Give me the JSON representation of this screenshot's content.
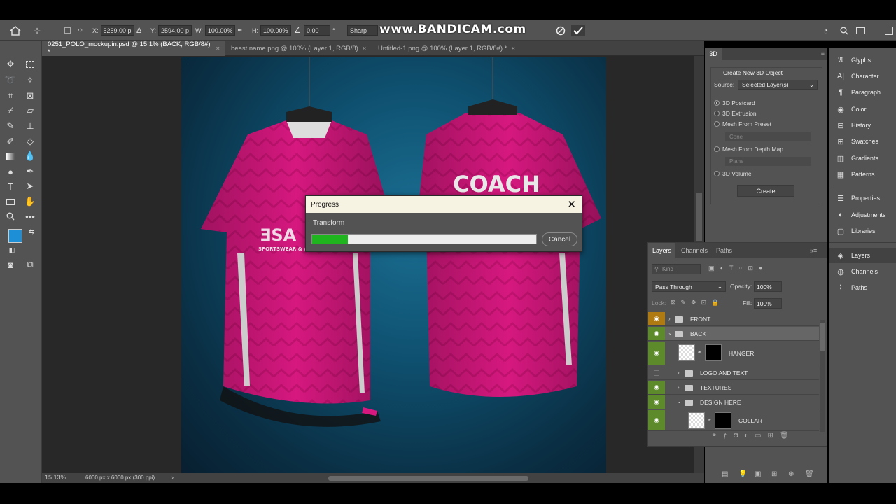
{
  "options_bar": {
    "x_label": "X:",
    "x_value": "5259.00 p",
    "y_label": "Y:",
    "y_value": "2594.00 p",
    "w_label": "W:",
    "w_value": "100.00%",
    "h_label": "H:",
    "h_value": "100.00%",
    "angle_value": "0.00",
    "angle_unit": "°",
    "interp_value": "Sharp",
    "watermark": "www.BANDICAM.com"
  },
  "tabs": [
    {
      "label": "0251_POLO_mockupin.psd @ 15.1% (BACK, RGB/8#) *",
      "close": "×"
    },
    {
      "label": "beast name.png @ 100% (Layer 1, RGB/8)",
      "close": "×"
    },
    {
      "label": "Untitled-1.png @ 100% (Layer 1, RGB/8#) *",
      "close": "×"
    }
  ],
  "artwork": {
    "front_logo_text": "ƎSA",
    "front_logo_sub": "SPORTSWEAR & A",
    "back_text": "COACH",
    "shirt_color": "#d6187f",
    "bg_color": "#0e4f6e"
  },
  "status_bar": {
    "zoom": "15.13%",
    "doc_info": "6000 px x 6000 px (300 ppi)",
    "arrow": "›"
  },
  "progress_dialog": {
    "title": "Progress",
    "task": "Transform",
    "progress_fraction": 0.16,
    "cancel_label": "Cancel",
    "close": "✕"
  },
  "panel_3d": {
    "tab_label": "3D",
    "heading": "Create New 3D Object",
    "source_label": "Source:",
    "source_value": "Selected Layer(s)",
    "options": [
      {
        "label": "3D Postcard",
        "selected": true
      },
      {
        "label": "3D Extrusion",
        "selected": false
      },
      {
        "label": "Mesh From Preset",
        "selected": false
      },
      {
        "label": "Mesh From Depth Map",
        "selected": false
      },
      {
        "label": "3D Volume",
        "selected": false
      }
    ],
    "preset_value": "Cone",
    "depth_value": "Plane",
    "create_label": "Create"
  },
  "layers_panel": {
    "tabs": [
      "Layers",
      "Channels",
      "Paths"
    ],
    "kind_placeholder": "Kind",
    "blend_mode": "Pass Through",
    "opacity_label": "Opacity:",
    "opacity_value": "100%",
    "lock_label": "Lock:",
    "fill_label": "Fill:",
    "fill_value": "100%",
    "rows": [
      {
        "name": "FRONT",
        "type": "folder"
      },
      {
        "name": "BACK",
        "type": "folder"
      },
      {
        "name": "HANGER",
        "type": "layer"
      },
      {
        "name": "LOGO AND TEXT",
        "type": "folder"
      },
      {
        "name": "TEXTURES",
        "type": "folder"
      },
      {
        "name": "DESIGN HERE",
        "type": "folder"
      },
      {
        "name": "COLLAR",
        "type": "layer"
      }
    ]
  },
  "right_panels": {
    "group1": [
      "Glyphs",
      "Character",
      "Paragraph",
      "Color",
      "History",
      "Swatches",
      "Gradients",
      "Patterns"
    ],
    "group2": [
      "Properties",
      "Adjustments",
      "Libraries"
    ],
    "group3": [
      "Layers",
      "Channels",
      "Paths"
    ]
  },
  "colors": {
    "ui_bg": "#535353",
    "ui_dark": "#424242",
    "accent_blue": "#1c8fd6",
    "progress_green": "#1fb51f",
    "eye_green": "#5d8a2a",
    "eye_orange": "#b07a12"
  }
}
